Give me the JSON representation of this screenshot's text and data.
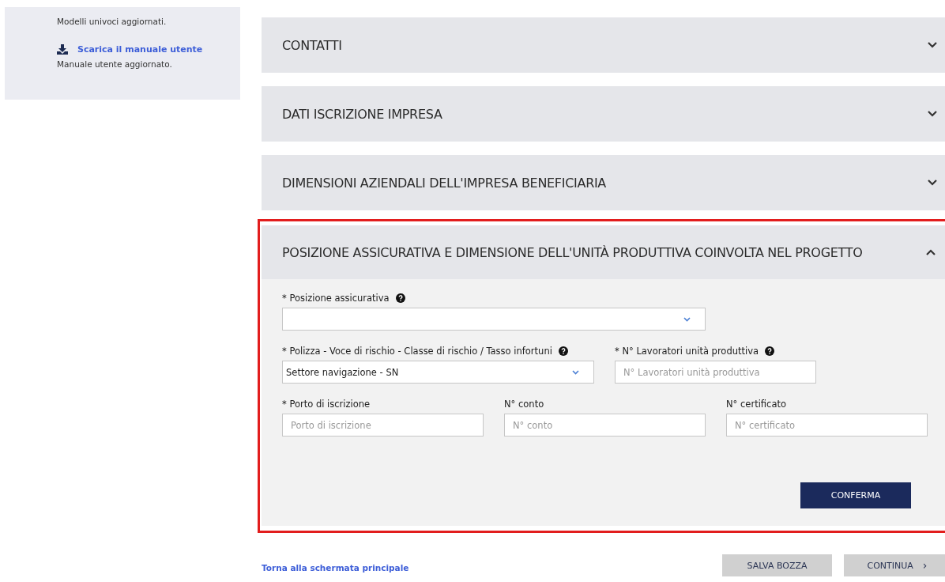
{
  "sidebar": {
    "note": "Modelli univoci aggiornati.",
    "download_link": "Scarica il manuale utente",
    "download_note": "Manuale utente aggiornato."
  },
  "sections": [
    {
      "title": "CONTATTI",
      "expanded": false,
      "highlighted": false
    },
    {
      "title": "DATI ISCRIZIONE IMPRESA",
      "expanded": false,
      "highlighted": false
    },
    {
      "title": "DIMENSIONI AZIENDALI DELL'IMPRESA BENEFICIARIA",
      "expanded": false,
      "highlighted": false
    },
    {
      "title": "POSIZIONE ASSICURATIVA E DIMENSIONE DELL'UNITÀ PRODUTTIVA COINVOLTA NEL PROGETTO",
      "expanded": true,
      "highlighted": true,
      "form": {
        "rows": [
          [
            {
              "kind": "select",
              "label": "* Posizione assicurativa",
              "help": true
            }
          ],
          [
            {
              "kind": "select",
              "label": "* Polizza - Voce di rischio - Classe di rischio / Tasso infortuni",
              "help": true,
              "value": "Settore navigazione - SN"
            },
            {
              "kind": "input",
              "label": "* N° Lavoratori unità produttiva",
              "help": true,
              "placeholder": "N° Lavoratori unità produttiva"
            }
          ],
          [
            {
              "kind": "input",
              "label": "* Porto di iscrizione",
              "help": false,
              "placeholder": "Porto di iscrizione"
            },
            {
              "kind": "input",
              "label": "N° conto",
              "help": false,
              "placeholder": "N° conto"
            },
            {
              "kind": "input",
              "label": "N° certificato",
              "help": false,
              "placeholder": "N° certificato"
            }
          ]
        ],
        "confirm_button": "CONFERMA"
      }
    }
  ],
  "footer": {
    "back_link": "Torna alla schermata principale",
    "save_button": "SALVA BOZZA",
    "continue_button": "CONTINUA",
    "continue_icon": "›"
  }
}
